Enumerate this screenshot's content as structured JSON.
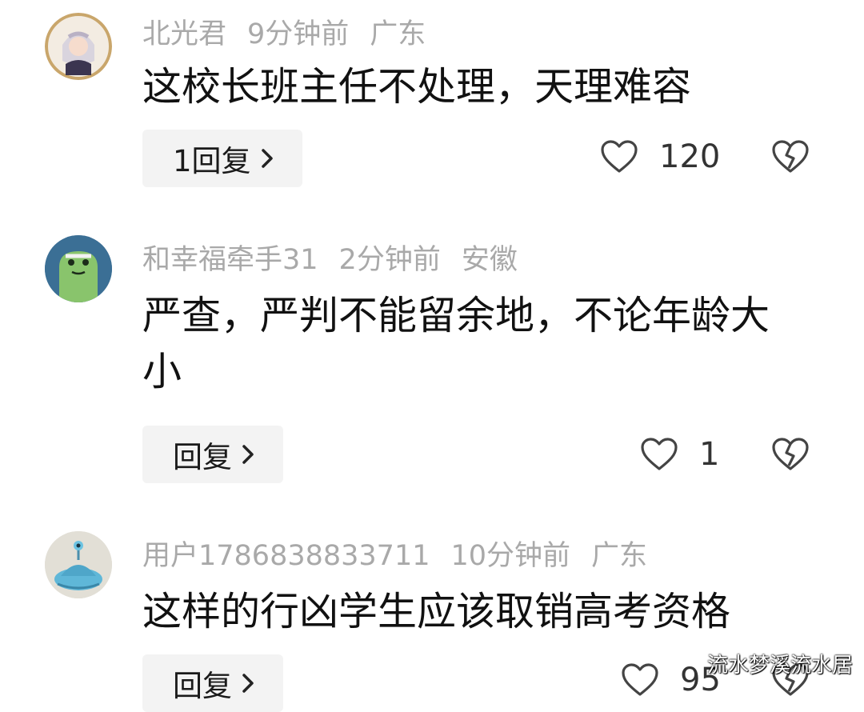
{
  "comments": [
    {
      "username": "北光君",
      "time": "9分钟前",
      "location": "广东",
      "text": "这校长班主任不处理，天理难容",
      "reply_label": "1回复",
      "likes": "120",
      "avatar_icon": "anime-girl-avatar"
    },
    {
      "username": "和幸福牵手31",
      "time": "2分钟前",
      "location": "安徽",
      "text": "严查，严判不能留余地，不论年龄大小",
      "reply_label": "回复",
      "likes": "1",
      "avatar_icon": "green-frog-avatar"
    },
    {
      "username": "用户1786838833711",
      "time": "10分钟前",
      "location": "广东",
      "text": "这样的行凶学生应该取销高考资格",
      "reply_label": "回复",
      "likes": "95",
      "avatar_icon": "blue-alien-avatar"
    }
  ],
  "icons": {
    "like": "heart-outline-icon",
    "dislike": "broken-heart-icon",
    "chevron": "chevron-right-icon"
  },
  "watermark": "流水梦溪流水居",
  "colors": {
    "meta_text": "#a9a9a9",
    "content_text": "#111111",
    "reply_bg": "#f3f3f3",
    "icon_stroke": "#444444"
  }
}
